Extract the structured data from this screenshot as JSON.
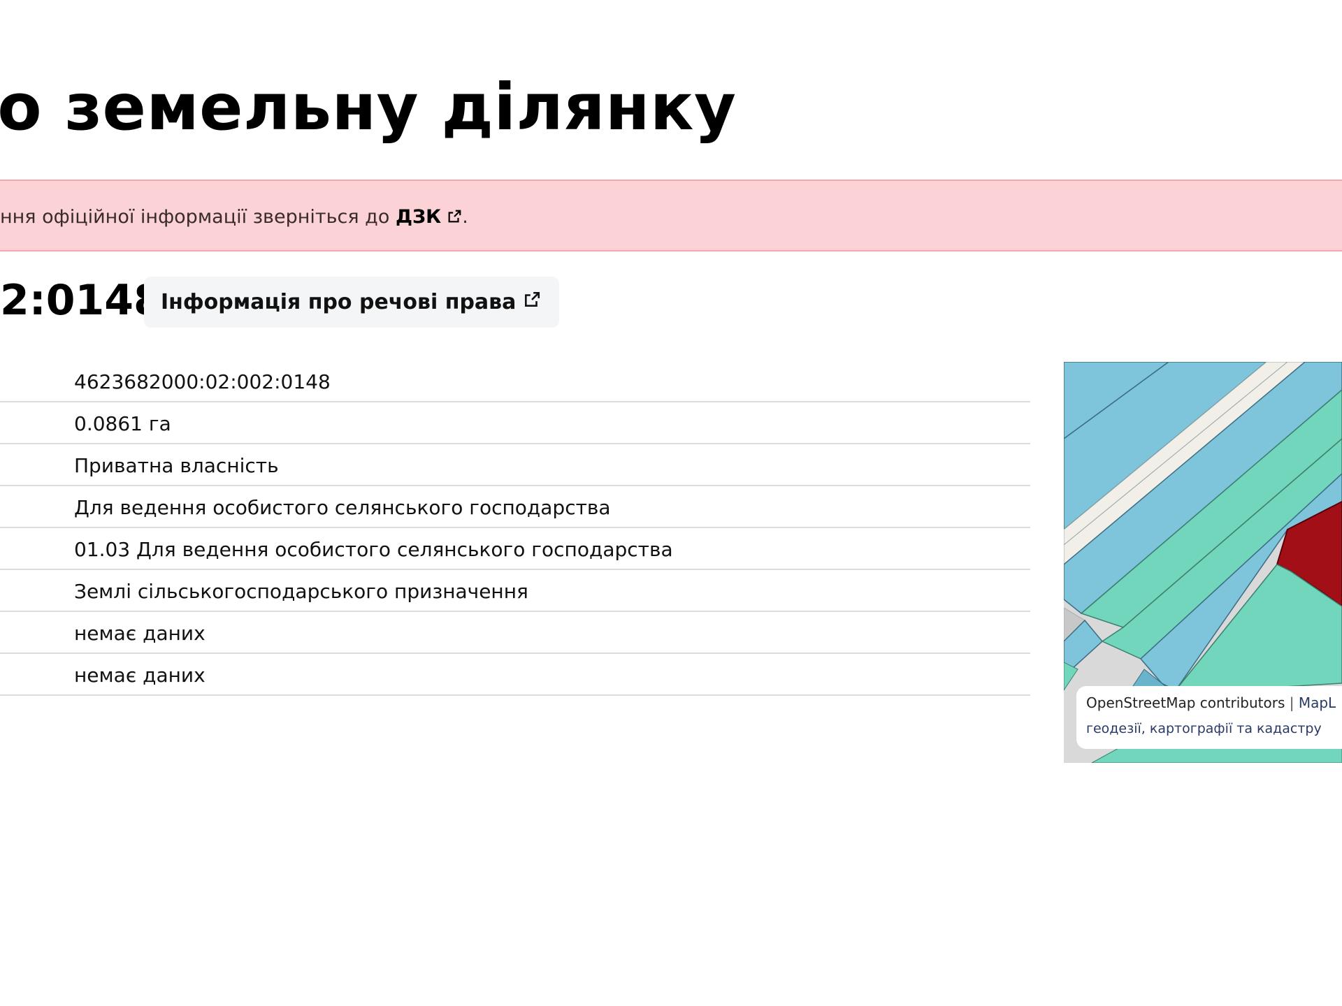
{
  "page": {
    "title": "ро земельну ділянку"
  },
  "alert": {
    "text": "ння офіційної інформації зверніться до ",
    "link_label": "ДЗК",
    "suffix": "."
  },
  "parcel": {
    "cadastral_fragment": "2:0148",
    "rights_button_label": "Інформація про речові права"
  },
  "table": {
    "rows": [
      {
        "value": "4623682000:02:002:0148"
      },
      {
        "value": "0.0861 га"
      },
      {
        "value": "Приватна власність"
      },
      {
        "value": "Для ведення особистого селянського господарства"
      },
      {
        "value": "01.03 Для ведення особистого селянського господарства"
      },
      {
        "value": "Землі сільськогосподарського призначення"
      },
      {
        "value": "немає даних"
      },
      {
        "value": "немає даних"
      }
    ]
  },
  "map": {
    "attribution_osm": "OpenStreetMap contributors",
    "attribution_separator": "|",
    "attribution_maplib": "MapL",
    "attribution_line2": "геодезії, картографії та кадастру",
    "colors": {
      "blue_parcel": "#7ec4da",
      "green_parcel": "#72d6bc",
      "selected_parcel": "#a30f17",
      "road": "#f1efe8",
      "background": "#d9d9d9"
    }
  },
  "icons": {
    "external_link": "external-link-icon"
  }
}
